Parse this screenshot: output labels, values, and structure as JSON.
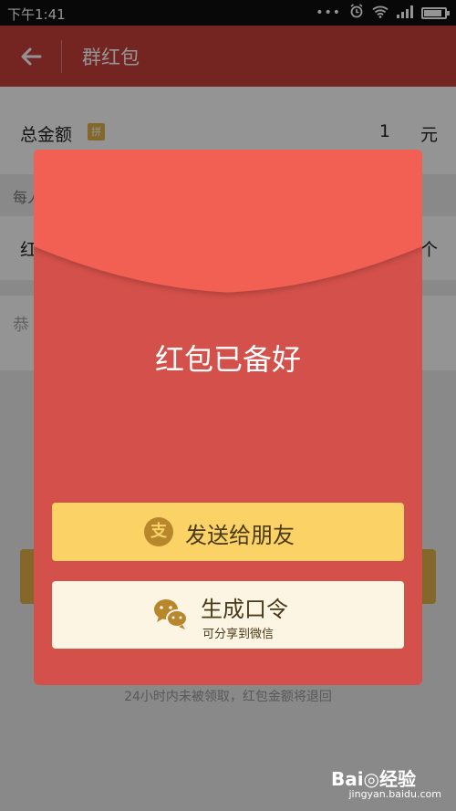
{
  "status_bar": {
    "time": "下午1:41"
  },
  "app_bar": {
    "title": "群红包"
  },
  "form": {
    "total_label": "总金额",
    "pin_badge": "拼",
    "total_value": "1",
    "total_unit": "元",
    "hint_text": "每人",
    "count_label": "红",
    "count_unit": "个",
    "message_placeholder": "恭"
  },
  "footer_note": "24小时内未被领取，红包金额将退回",
  "modal": {
    "title": "红包已备好",
    "send_button_label": "发送给朋友",
    "send_icon_glyph": "支",
    "code_button_label": "生成口令",
    "code_button_sub": "可分享到微信"
  },
  "watermark": {
    "brand": "Bai◎经验",
    "url": "jingyan.baidu.com"
  },
  "colors": {
    "app_bar": "#c9403b",
    "envelope": "#d4504a",
    "flap": "#f25f52",
    "send_button": "#fbd265",
    "code_button": "#fdf5e3"
  }
}
